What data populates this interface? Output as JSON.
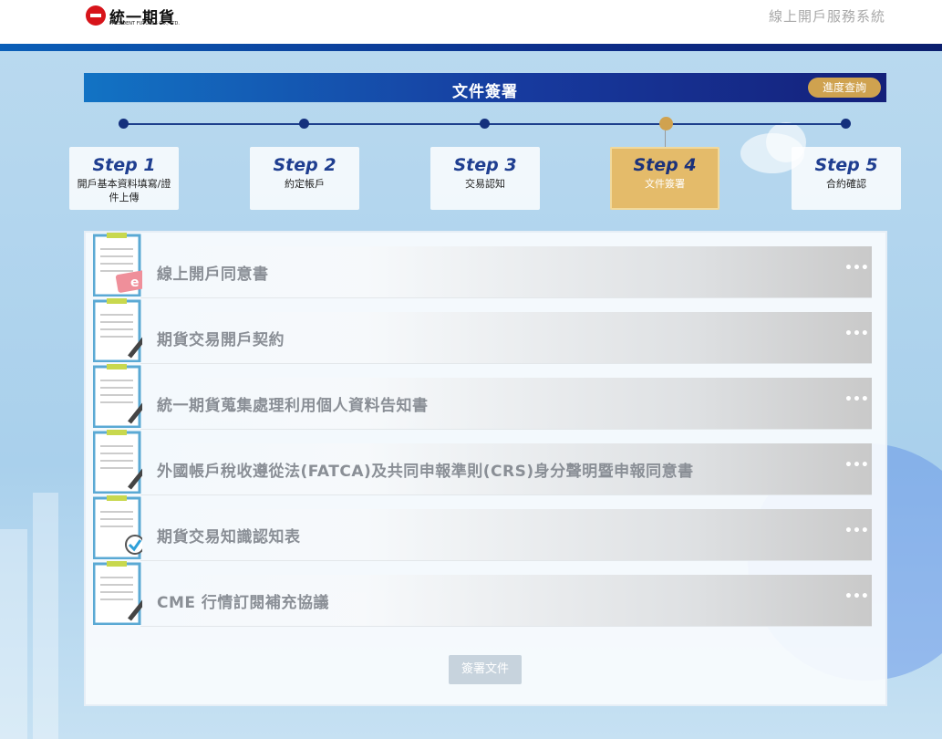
{
  "header": {
    "logo_text": "統一期貨",
    "logo_sub": "PRESIDENT FUTURES CO., LTD.",
    "system_title": "線上開戶服務系統"
  },
  "section": {
    "title": "文件簽署",
    "progress_button": "進度查詢"
  },
  "steps": [
    {
      "num": "Step 1",
      "label": "開戶基本資料填寫/證件上傳",
      "active": false
    },
    {
      "num": "Step 2",
      "label": "約定帳戶",
      "active": false
    },
    {
      "num": "Step 3",
      "label": "交易認知",
      "active": false
    },
    {
      "num": "Step 4",
      "label": "文件簽署",
      "active": true
    },
    {
      "num": "Step 5",
      "label": "合約確認",
      "active": false
    }
  ],
  "documents": [
    {
      "title": "線上開戶同意書",
      "icon": "e-document-icon",
      "more": "•••"
    },
    {
      "title": "期貨交易開戶契約",
      "icon": "sign-document-icon",
      "more": "•••"
    },
    {
      "title": "統一期貨蒐集處理利用個人資料告知書",
      "icon": "sign-document-icon",
      "more": "•••"
    },
    {
      "title": "外國帳戶稅收遵從法(FATCA)及共同申報準則(CRS)身分聲明暨申報同意書",
      "icon": "sign-document-icon",
      "more": "•••"
    },
    {
      "title": "期貨交易知識認知表",
      "icon": "check-document-icon",
      "more": "•••"
    },
    {
      "title": "CME 行情訂閱補充協議",
      "icon": "sign-document-icon",
      "more": "•••"
    }
  ],
  "sign_button": "簽署文件",
  "colors": {
    "accent_gold": "#cfa24f",
    "navy": "#1f3e90",
    "header_band": "#0d2d8a"
  }
}
